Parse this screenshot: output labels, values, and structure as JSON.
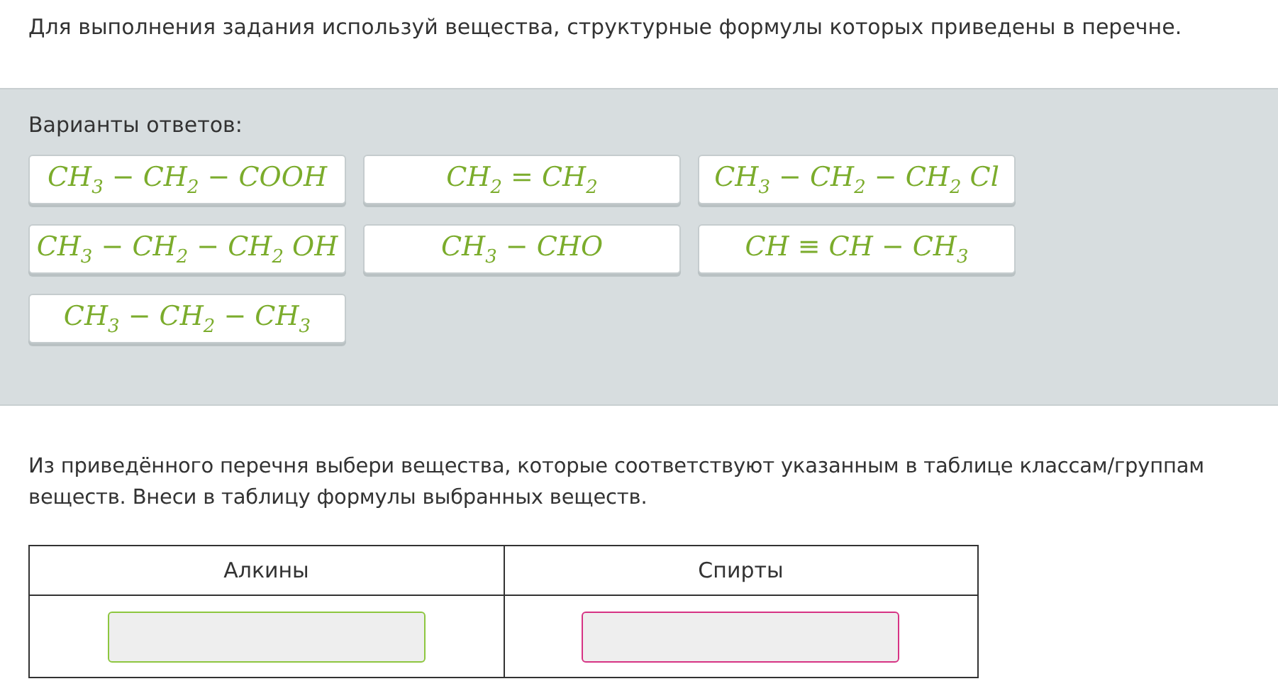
{
  "instruction": "Для выполнения задания используй вещества, структурные формулы которых приведены в перечне.",
  "options": {
    "title": "Варианты ответов:",
    "items": [
      "CH$_{3}$ − CH$_{2}$ − COOH",
      "CH$_{2}$ = CH$_{2}$",
      "CH$_{3}$ − CH$_{2}$ − CH$_{2}$ Cl",
      "CH$_{3}$ − CH$_{2}$ − CH$_{2}$ OH",
      "CH$_{3}$ − CHO",
      "CH ≡ CH − CH$_{3}$",
      "CH$_{3}$ − CH$_{2}$ − CH$_{3}$"
    ]
  },
  "question": "Из приведённого перечня выбери вещества, которые соответствуют указанным в таблице классам/группам веществ. Внеси в таблицу формулы выбранных веществ.",
  "table": {
    "columns": [
      {
        "header": "Алкины",
        "color": "#8dc63f"
      },
      {
        "header": "Спирты",
        "color": "#d63384"
      }
    ]
  }
}
